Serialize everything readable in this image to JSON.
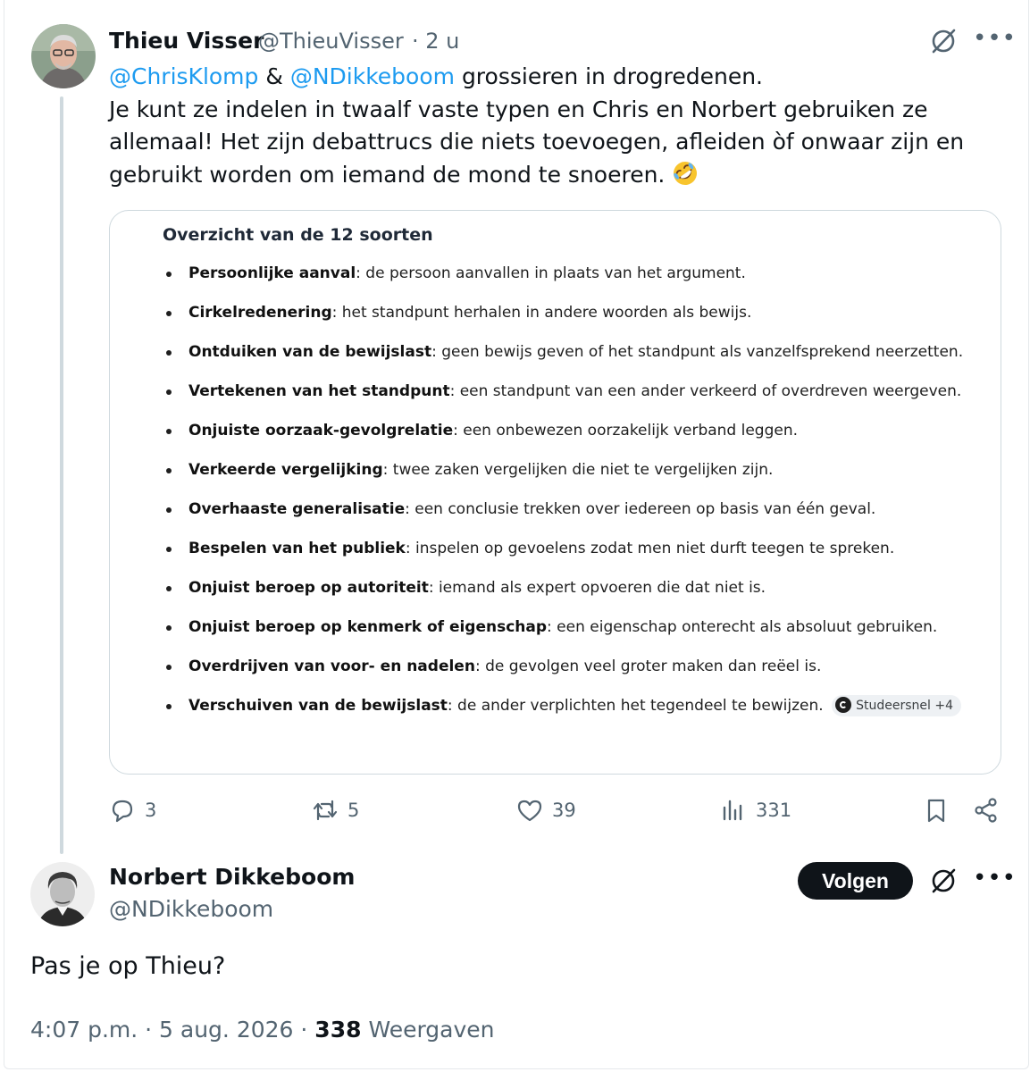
{
  "tweet": {
    "author_name": "Thieu Visser",
    "author_handle": "@ThieuVisser",
    "time": "· 2 u",
    "mention1": "@ChrisKlomp",
    "amp": "&",
    "mention2": "@NDikkeboom",
    "line1_rest": "grossieren in drogredenen.",
    "line2": "Je kunt ze indelen in twaalf vaste typen en Chris en Norbert gebruiken ze allemaal! Het zijn debattrucs die niets toevoegen, afleiden òf onwaar zijn en gebruikt worden om iemand de mond te snoeren.",
    "emoji": "rolling-on-floor-laughing",
    "card": {
      "title": "Overzicht van de 12 soorten",
      "items": [
        {
          "term": "Persoonlijke aanval",
          "desc": ": de persoon aanvallen in plaats van het argument."
        },
        {
          "term": "Cirkelredenering",
          "desc": ": het standpunt herhalen in andere woorden als bewijs."
        },
        {
          "term": "Ontduiken van de bewijslast",
          "desc": ": geen bewijs geven of het standpunt als vanzelfsprekend neerzetten."
        },
        {
          "term": "Vertekenen van het standpunt",
          "desc": ": een standpunt van een ander verkeerd of overdreven weergeven."
        },
        {
          "term": "Onjuiste oorzaak-gevolgrelatie",
          "desc": ": een onbewezen oorzakelijk verband leggen."
        },
        {
          "term": "Verkeerde vergelijking",
          "desc": ": twee zaken vergelijken die niet te vergelijken zijn."
        },
        {
          "term": "Overhaaste generalisatie",
          "desc": ": een conclusie trekken over iedereen op basis van één geval."
        },
        {
          "term": "Bespelen van het publiek",
          "desc": ": inspelen op gevoelens zodat men niet durft teegen te spreken."
        },
        {
          "term": "Onjuist beroep op autoriteit",
          "desc": ": iemand als expert opvoeren die dat niet is."
        },
        {
          "term": "Onjuist beroep op kenmerk of eigenschap",
          "desc": ": een eigenschap onterecht als absoluut gebruiken."
        },
        {
          "term": "Overdrijven van voor- en nadelen",
          "desc": ": de gevolgen veel groter maken dan reëel is."
        },
        {
          "term": "Verschuiven van de bewijslast",
          "desc": ": de ander verplichten het tegendeel te bewijzen."
        }
      ],
      "source_chip": "Studeersnel +4"
    },
    "actions": {
      "replies": "3",
      "reposts": "5",
      "likes": "39",
      "views": "331"
    }
  },
  "reply": {
    "author_name": "Norbert Dikkeboom",
    "author_handle": "@NDikkeboom",
    "follow_label": "Volgen",
    "text": "Pas je op Thieu?",
    "time": "4:07 p.m. · 5 aug. 2026 ·",
    "views_count": "338",
    "views_label": "Weergaven"
  },
  "icons": [
    "grok-strike-icon",
    "more-icon",
    "reply-icon",
    "repost-icon",
    "like-icon",
    "views-icon",
    "bookmark-icon",
    "share-icon"
  ],
  "colors": {
    "link": "#1d9bf0",
    "muted": "#536471",
    "text": "#0f1419"
  }
}
